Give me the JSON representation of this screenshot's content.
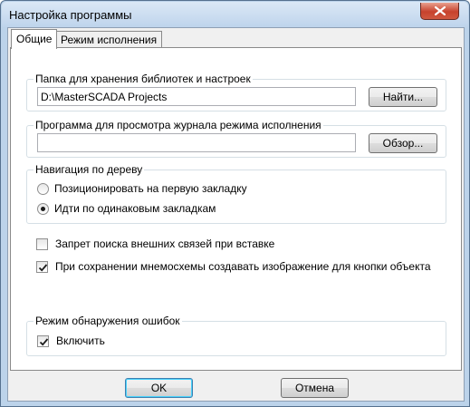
{
  "window": {
    "title": "Настройка программы"
  },
  "tabs": [
    {
      "label": "Общие",
      "active": true
    },
    {
      "label": "Режим исполнения",
      "active": false
    }
  ],
  "library_folder": {
    "legend": "Папка для хранения библиотек и настроек",
    "value": "D:\\MasterSCADA Projects",
    "button": "Найти..."
  },
  "journal_viewer": {
    "legend": "Программа для просмотра журнала режима исполнения",
    "value": "",
    "button": "Обзор..."
  },
  "tree_navigation": {
    "legend": "Навигация по дереву",
    "options": [
      {
        "label": "Позиционировать на первую закладку",
        "checked": false
      },
      {
        "label": "Идти по одинаковым закладкам",
        "checked": true
      }
    ]
  },
  "options": [
    {
      "label": "Запрет поиска внешних связей при вставке",
      "checked": false
    },
    {
      "label": "При сохранении мнемосхемы создавать изображение для кнопки объекта",
      "checked": true
    }
  ],
  "error_detection": {
    "legend": "Режим обнаружения ошибок",
    "enable_label": "Включить",
    "enabled": true
  },
  "buttons": {
    "ok": "OK",
    "cancel": "Отмена"
  },
  "icons": {
    "close": "close-icon",
    "check": "checkmark-icon"
  },
  "colors": {
    "close_button": "#c7422d",
    "default_button_border": "#3c7fb1"
  }
}
